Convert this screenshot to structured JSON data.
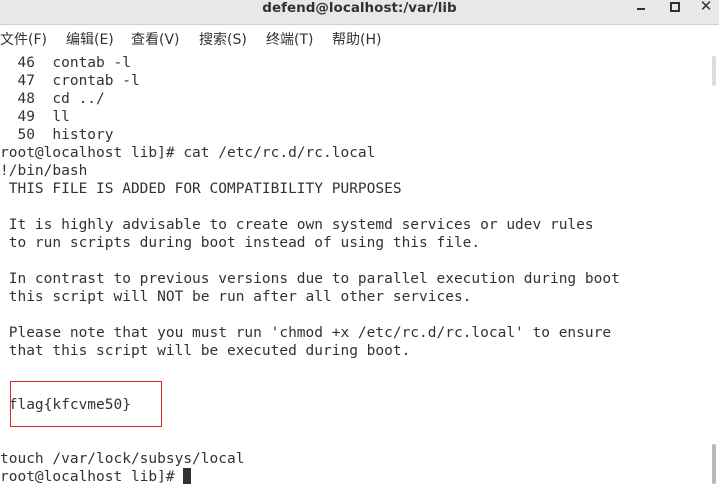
{
  "window": {
    "title": "defend@localhost:/var/lib"
  },
  "menu": [
    {
      "label": "文件(F)"
    },
    {
      "label": "编辑(E)"
    },
    {
      "label": "查看(V)"
    },
    {
      "label": "搜索(S)"
    },
    {
      "label": "终端(T)"
    },
    {
      "label": "帮助(H)"
    }
  ],
  "terminal": {
    "lines": [
      "  46  contab -l",
      "  47  crontab -l",
      "  48  cd ../",
      "  49  ll",
      "  50  history",
      "root@localhost lib]# cat /etc/rc.d/rc.local",
      "!/bin/bash",
      " THIS FILE IS ADDED FOR COMPATIBILITY PURPOSES",
      "",
      " It is highly advisable to create own systemd services or udev rules",
      " to run scripts during boot instead of using this file.",
      "",
      " In contrast to previous versions due to parallel execution during boot",
      " this script will NOT be run after all other services.",
      "",
      " Please note that you must run 'chmod +x /etc/rc.d/rc.local' to ensure",
      " that this script will be executed during boot.",
      "",
      "",
      " flag{kfcvme50}",
      "",
      "",
      "touch /var/lock/subsys/local",
      "root@localhost lib]# "
    ]
  }
}
